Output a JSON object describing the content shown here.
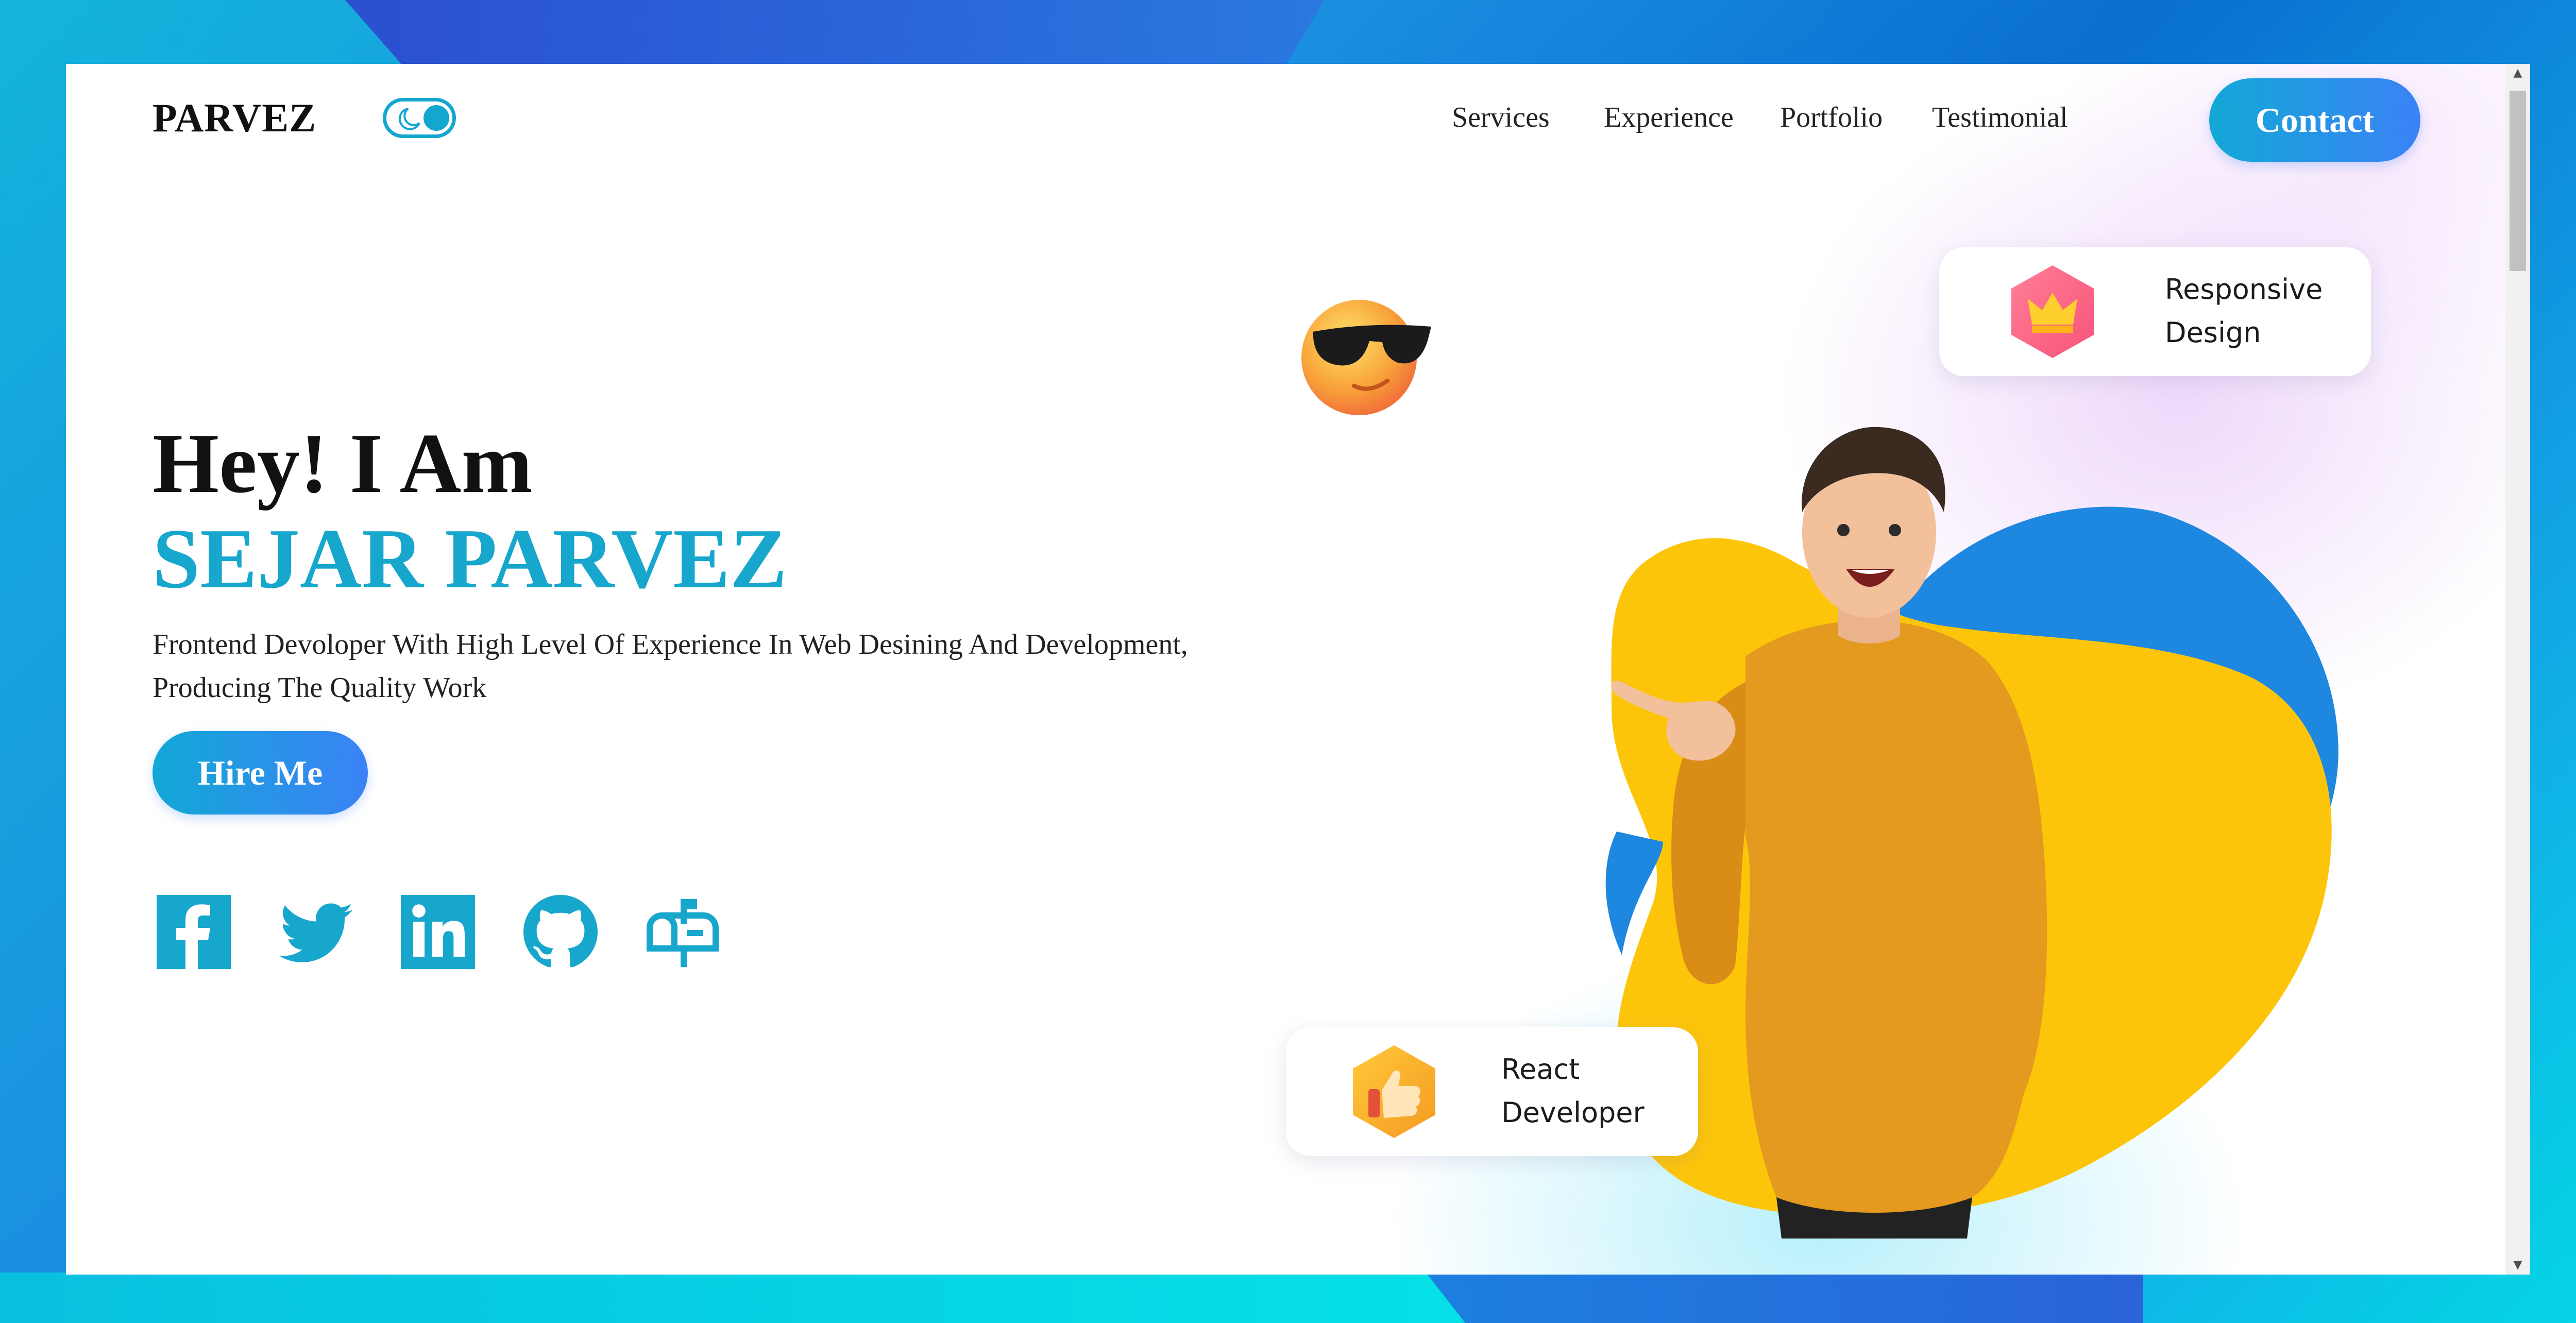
{
  "nav": {
    "logo": "PARVEZ",
    "links": [
      "Services",
      "Experience",
      "Portfolio",
      "Testimonial"
    ],
    "contact_label": "Contact"
  },
  "hero": {
    "greeting": "Hey! I Am",
    "name": "SEJAR PARVEZ",
    "description": "Frontend Devoloper With High Level Of Experience In Web Desining And Development, Producing The Quality Work",
    "hire_label": "Hire Me"
  },
  "social_icons": [
    "facebook-icon",
    "twitter-icon",
    "linkedin-icon",
    "github-icon",
    "mailbox-icon"
  ],
  "cards": {
    "responsive": {
      "line1": "Responsive",
      "line2": "Design",
      "icon": "crown-icon"
    },
    "react": {
      "line1": "React",
      "line2": "Developer",
      "icon": "thumbs-up-icon"
    }
  },
  "colors": {
    "accent": "#17a6cc",
    "button_gradient_start": "#12a8d6",
    "button_gradient_end": "#3b82f6",
    "blob_yellow": "#fdc50a",
    "blob_blue": "#1e88e0",
    "sweater": "#e39a1e"
  }
}
